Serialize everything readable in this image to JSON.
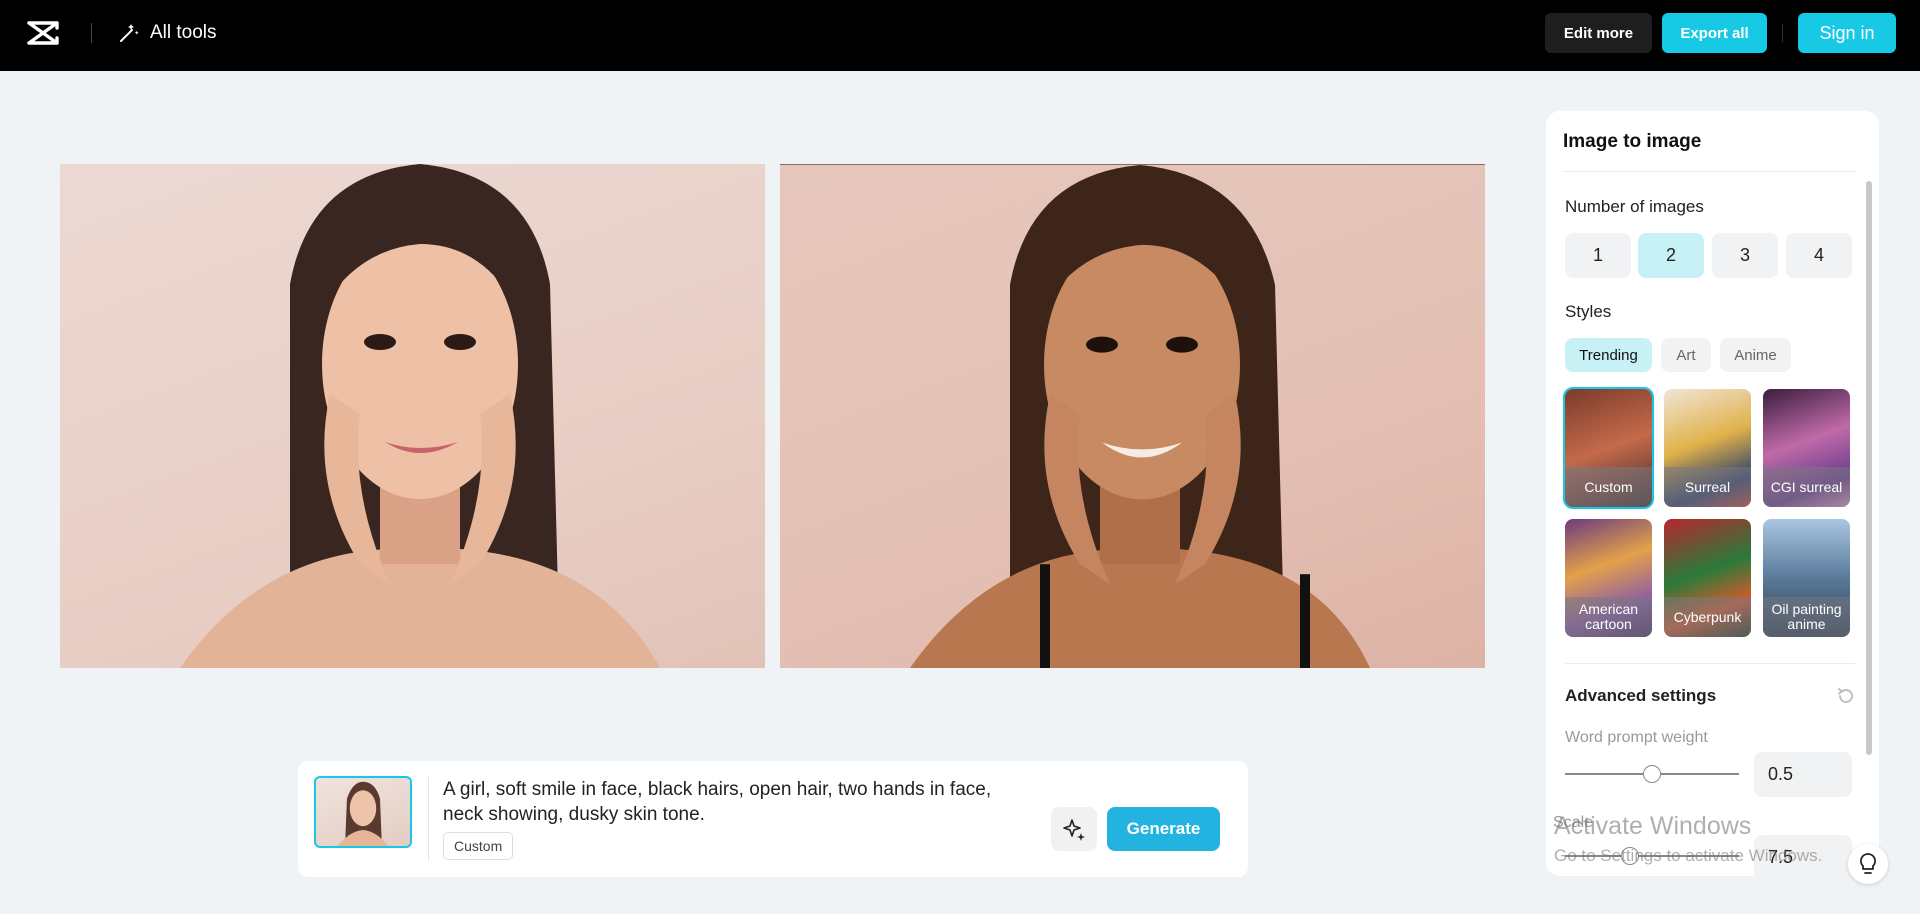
{
  "header": {
    "logo_icon": "capcut-logo-icon",
    "all_tools_label": "All tools",
    "edit_more_label": "Edit more",
    "export_all_label": "Export all",
    "sign_in_label": "Sign in",
    "accent_color": "#17c9e4"
  },
  "canvas": {
    "images": [
      "generated-portrait-1",
      "generated-portrait-2"
    ]
  },
  "panel": {
    "title": "Image to image",
    "number_of_images": {
      "label": "Number of images",
      "options": [
        "1",
        "2",
        "3",
        "4"
      ],
      "selected": "2"
    },
    "styles": {
      "label": "Styles",
      "tabs": [
        "Trending",
        "Art",
        "Anime"
      ],
      "active_tab": "Trending",
      "cards": [
        "Custom",
        "Surreal",
        "CGI surreal",
        "American cartoon",
        "Cyberpunk",
        "Oil painting anime"
      ],
      "selected": "Custom"
    },
    "advanced": {
      "title": "Advanced settings",
      "word_prompt_weight_label": "Word prompt weight",
      "word_prompt_weight_value": "0.5",
      "scale_label": "Scale",
      "scale_value": "7.5"
    }
  },
  "prompt": {
    "text": "A girl, soft smile in face, black hairs, open hair, two hands in face, neck showing, dusky skin tone.",
    "style_tag": "Custom",
    "generate_label": "Generate"
  },
  "watermark": {
    "line1": "Activate Windows",
    "line2": "Go to Settings to activate Windows."
  }
}
